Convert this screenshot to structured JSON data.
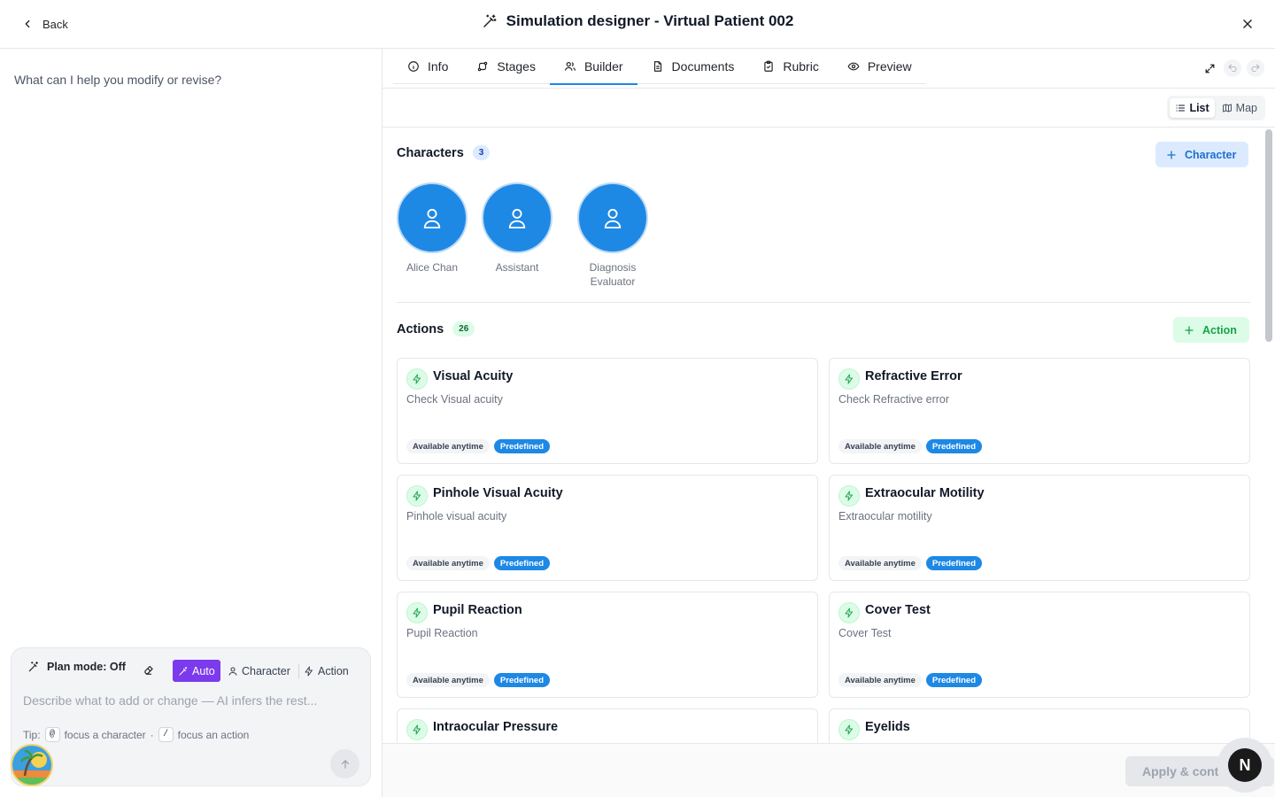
{
  "header": {
    "back_label": "Back",
    "title": "Simulation designer - Virtual Patient 002",
    "icons": {
      "back": "chevron-left-icon",
      "title": "magic-wand-icon",
      "close": "close-icon"
    }
  },
  "assistant": {
    "prompt_hint": "What can I help you modify or revise?",
    "plan_mode_label": "Plan mode: Off",
    "modes": [
      {
        "label": "Auto",
        "selected": true,
        "icon": "magic-wand-icon"
      },
      {
        "label": "Character",
        "selected": false,
        "icon": "user-icon"
      },
      {
        "label": "Action",
        "selected": false,
        "icon": "bolt-icon"
      }
    ],
    "input_placeholder": "Describe what to add or change — AI infers the rest...",
    "tip": {
      "prefix": "Tip:",
      "key1": "@",
      "text1": "focus a character",
      "separator": "·",
      "key2": "/",
      "text2": "focus an action"
    }
  },
  "tabs": [
    {
      "label": "Info",
      "icon": "info-icon",
      "active": false
    },
    {
      "label": "Stages",
      "icon": "stages-icon",
      "active": false
    },
    {
      "label": "Builder",
      "icon": "users-icon",
      "active": true
    },
    {
      "label": "Documents",
      "icon": "document-icon",
      "active": false
    },
    {
      "label": "Rubric",
      "icon": "clipboard-icon",
      "active": false
    },
    {
      "label": "Preview",
      "icon": "eye-icon",
      "active": false
    }
  ],
  "view_toggle": {
    "list": "List",
    "map": "Map",
    "selected": "List"
  },
  "characters": {
    "title": "Characters",
    "count": "3",
    "add_label": "Character",
    "items": [
      {
        "name": "Alice Chan"
      },
      {
        "name": "Assistant"
      },
      {
        "name": "Diagnosis Evaluator"
      }
    ]
  },
  "actions": {
    "title": "Actions",
    "count": "26",
    "add_label": "Action",
    "items": [
      {
        "title": "Visual Acuity",
        "desc": "Check Visual acuity",
        "availability": "Available anytime",
        "tag": "Predefined"
      },
      {
        "title": "Refractive Error",
        "desc": "Check Refractive error",
        "availability": "Available anytime",
        "tag": "Predefined"
      },
      {
        "title": "Pinhole Visual Acuity",
        "desc": "Pinhole visual acuity",
        "availability": "Available anytime",
        "tag": "Predefined"
      },
      {
        "title": "Extraocular Motility",
        "desc": "Extraocular motility",
        "availability": "Available anytime",
        "tag": "Predefined"
      },
      {
        "title": "Pupil Reaction",
        "desc": "Pupil Reaction",
        "availability": "Available anytime",
        "tag": "Predefined"
      },
      {
        "title": "Cover Test",
        "desc": "Cover Test",
        "availability": "Available anytime",
        "tag": "Predefined"
      },
      {
        "title": "Intraocular Pressure",
        "desc": "",
        "availability": "",
        "tag": ""
      },
      {
        "title": "Eyelids",
        "desc": "",
        "availability": "",
        "tag": ""
      }
    ]
  },
  "footer": {
    "apply_label": "Apply & cont"
  },
  "help_fab_label": "N",
  "colors": {
    "accent": "#1e88e5",
    "auto_mode": "#7c3aed",
    "action_green": "#16a34a"
  }
}
